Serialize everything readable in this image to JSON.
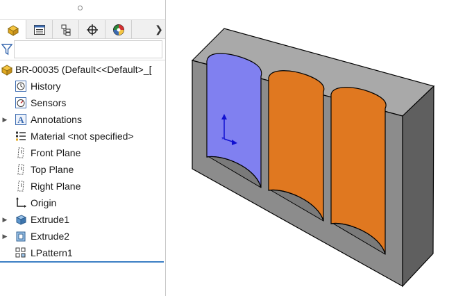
{
  "tree": {
    "root": {
      "label": "BR-00035  (Default<<Default>_["
    },
    "items": [
      {
        "label": "History",
        "icon": "history-icon",
        "expandable": false
      },
      {
        "label": "Sensors",
        "icon": "sensors-icon",
        "expandable": false
      },
      {
        "label": "Annotations",
        "icon": "annotations-icon",
        "expandable": true
      },
      {
        "label": "Material <not specified>",
        "icon": "material-icon",
        "expandable": false
      },
      {
        "label": "Front Plane",
        "icon": "plane-icon",
        "expandable": false
      },
      {
        "label": "Top Plane",
        "icon": "plane-icon",
        "expandable": false
      },
      {
        "label": "Right Plane",
        "icon": "plane-icon",
        "expandable": false
      },
      {
        "label": "Origin",
        "icon": "origin-icon",
        "expandable": false
      },
      {
        "label": "Extrude1",
        "icon": "extrude-icon",
        "expandable": true
      },
      {
        "label": "Extrude2",
        "icon": "extrude-icon",
        "expandable": true
      },
      {
        "label": "LPattern1",
        "icon": "linear-pattern-icon",
        "expandable": false
      }
    ]
  },
  "tabs": [
    {
      "name": "feature-manager-tab",
      "icon": "part-icon",
      "active": true
    },
    {
      "name": "property-manager-tab",
      "icon": "property-manager-icon",
      "active": false
    },
    {
      "name": "configuration-manager-tab",
      "icon": "configuration-icon",
      "active": false
    },
    {
      "name": "dimxpert-manager-tab",
      "icon": "crosshair-icon",
      "active": false
    },
    {
      "name": "display-manager-tab",
      "icon": "appearance-icon",
      "active": false
    }
  ],
  "colors": {
    "selected_face": "#8080f0",
    "cylinder_orange": "#e07820",
    "body_gray": "#8c8c8c",
    "selection_line": "#3c7fc4"
  }
}
